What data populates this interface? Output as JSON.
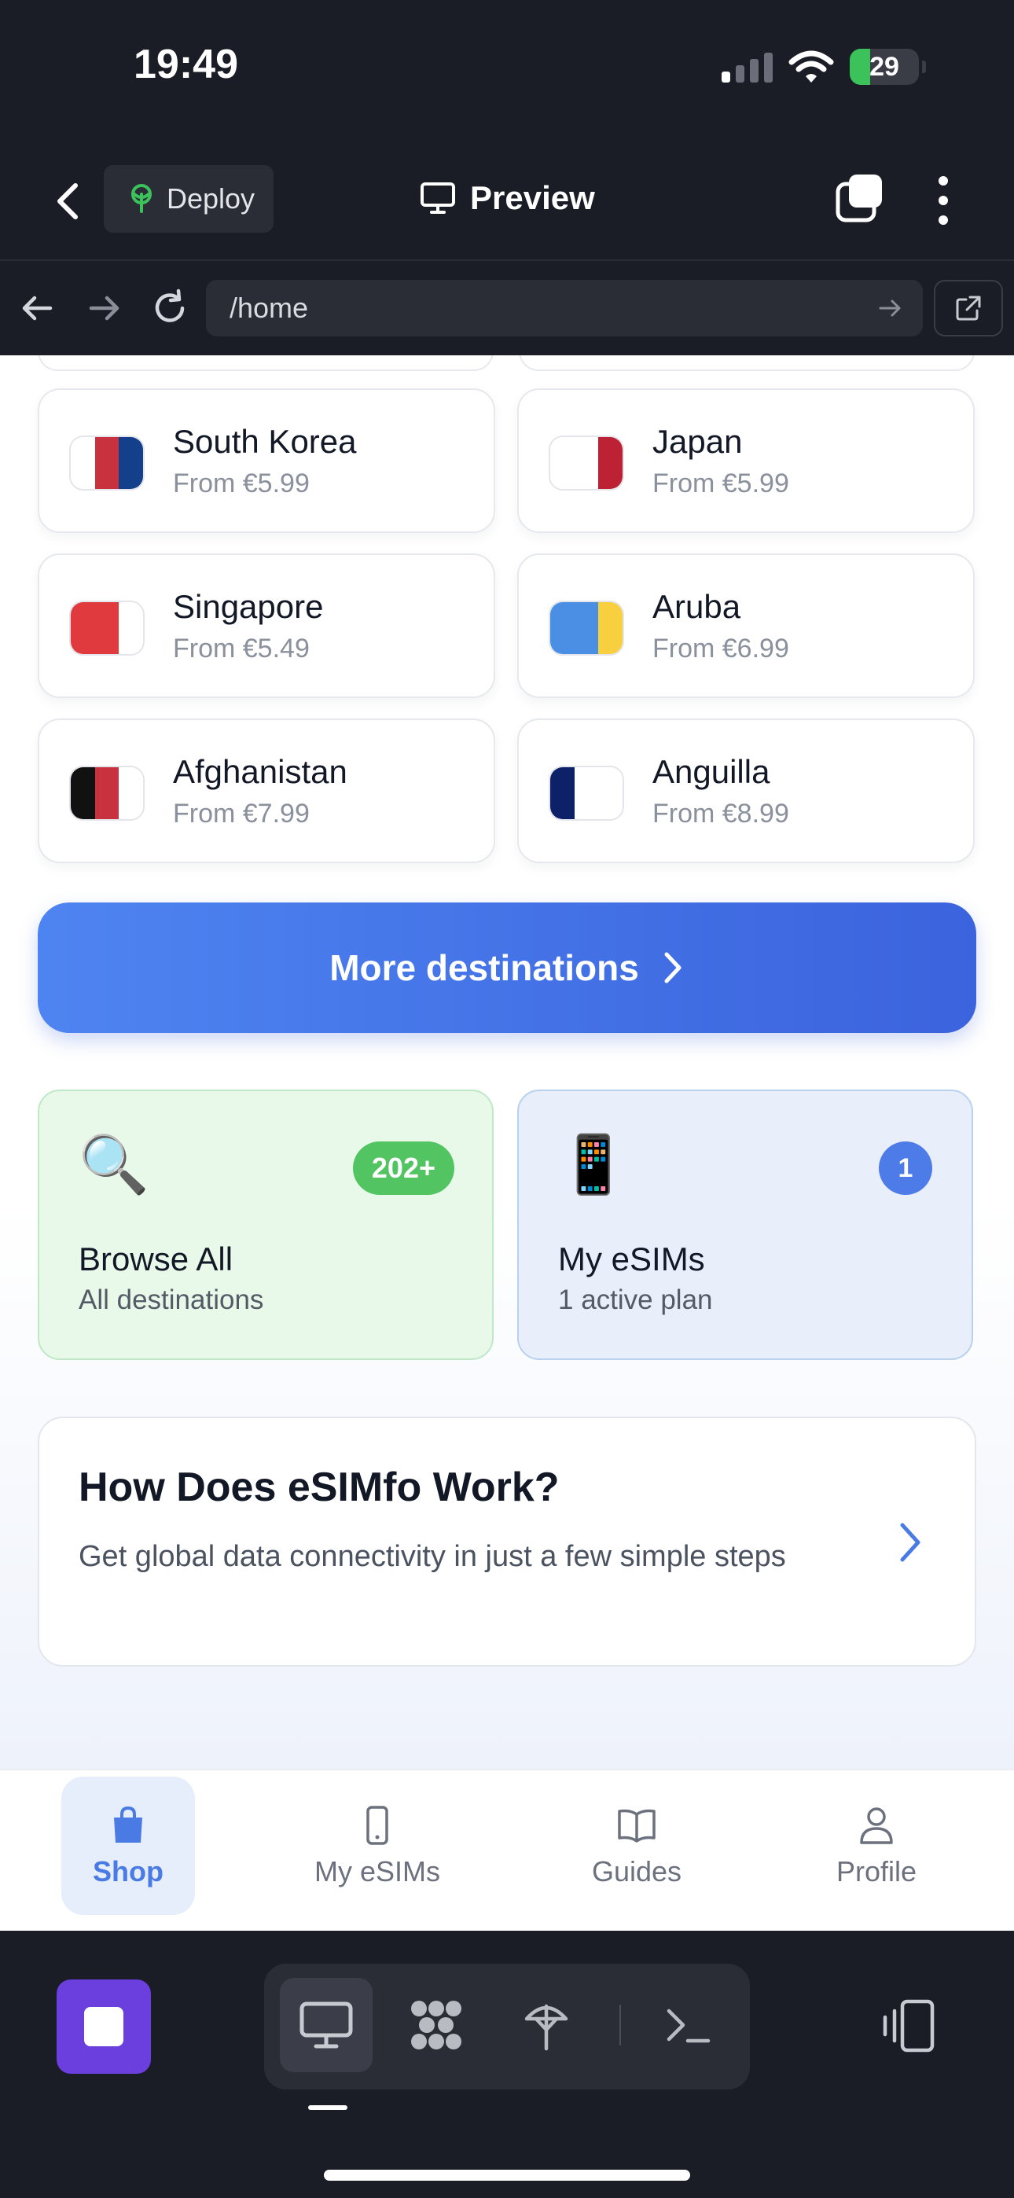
{
  "status_bar": {
    "time": "19:49",
    "battery": "29"
  },
  "header": {
    "back_icon": "chevron-left-icon",
    "deploy_label": "Deploy",
    "preview_label": "Preview",
    "tabs_icon": "tabs-icon",
    "more_icon": "more-vertical-icon"
  },
  "url_bar": {
    "path": "/home"
  },
  "destinations": [
    {
      "name": "South Korea",
      "price": "From €5.99",
      "flag": [
        "#ffffff",
        "#c8313e",
        "#133f8b"
      ]
    },
    {
      "name": "Japan",
      "price": "From €5.99",
      "flag": [
        "#ffffff",
        "#ffffff",
        "#bc2134"
      ]
    },
    {
      "name": "Singapore",
      "price": "From €5.49",
      "flag": [
        "#e03a3e",
        "#e03a3e",
        "#ffffff"
      ]
    },
    {
      "name": "Aruba",
      "price": "From €6.99",
      "flag": [
        "#4a8fe4",
        "#4a8fe4",
        "#f8cf3f"
      ]
    },
    {
      "name": "Afghanistan",
      "price": "From €7.99",
      "flag": [
        "#111111",
        "#c8313e",
        "#ffffff"
      ]
    },
    {
      "name": "Anguilla",
      "price": "From €8.99",
      "flag": [
        "#0c2168",
        "#ffffff",
        "#ffffff"
      ]
    }
  ],
  "more_destinations": {
    "label": "More destinations"
  },
  "browse_all": {
    "emoji": "🔍",
    "badge": "202+",
    "title": "Browse All",
    "subtitle": "All destinations"
  },
  "my_esims_card": {
    "emoji": "📱",
    "badge": "1",
    "title": "My eSIMs",
    "subtitle": "1 active plan"
  },
  "how_it_works": {
    "title": "How Does eSIMfo Work?",
    "description": "Get global data connectivity in just a few simple steps"
  },
  "tab_bar": {
    "items": [
      {
        "label": "Shop",
        "icon": "shopping-bag-icon",
        "active": true
      },
      {
        "label": "My eSIMs",
        "icon": "phone-icon",
        "active": false
      },
      {
        "label": "Guides",
        "icon": "book-icon",
        "active": false
      },
      {
        "label": "Profile",
        "icon": "user-icon",
        "active": false
      }
    ]
  },
  "colors": {
    "accent": "#4a7be4",
    "primary_button": "#3b63dd",
    "stop_button": "#6a3fde",
    "badge_green": "#52c462"
  }
}
